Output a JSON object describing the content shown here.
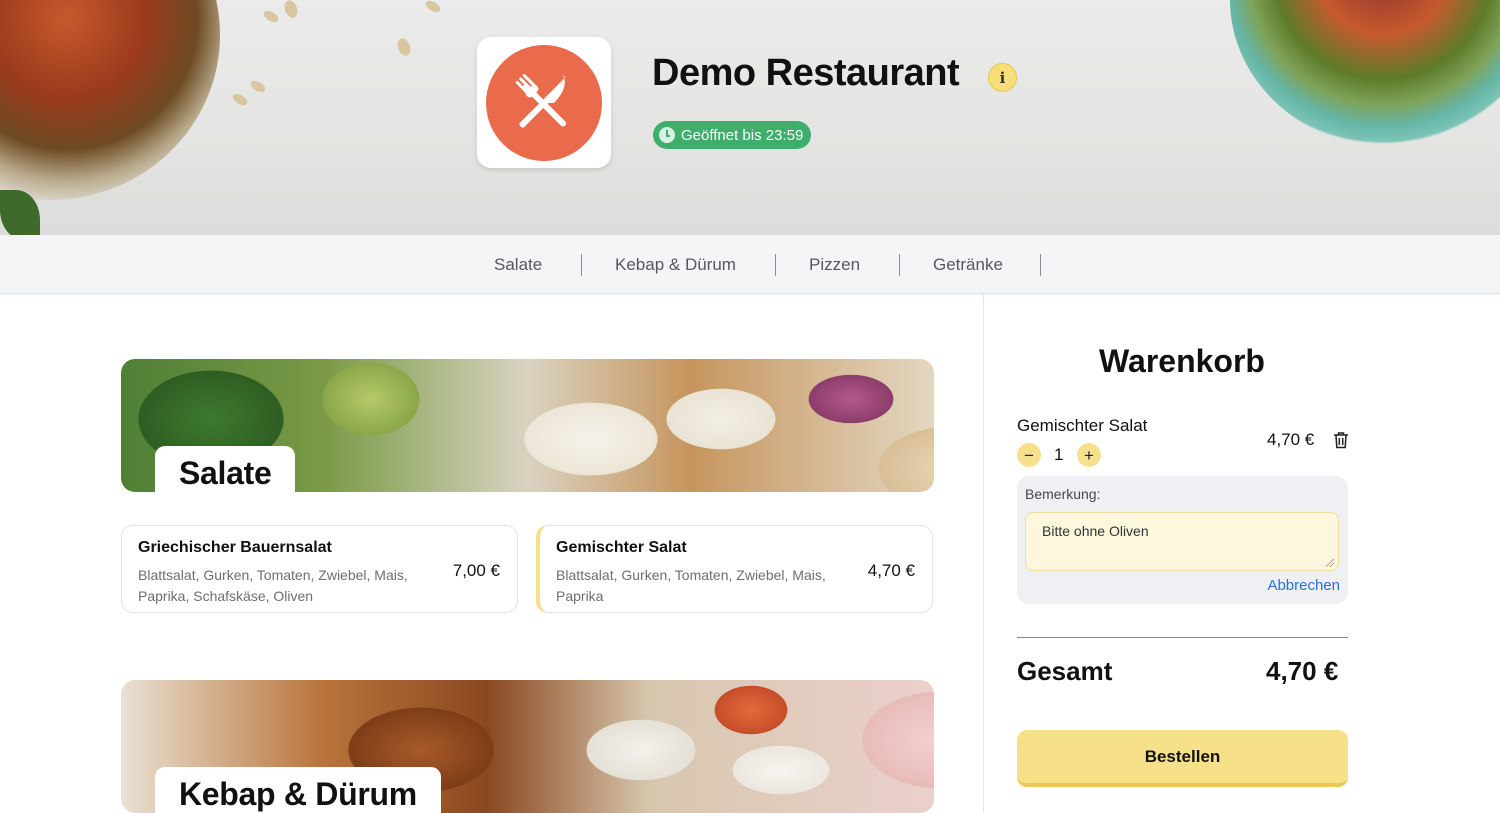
{
  "restaurant": {
    "name": "Demo Restaurant",
    "status": "Geöffnet bis 23:59",
    "info_icon": "i"
  },
  "nav": {
    "categories": [
      "Salate",
      "Kebap & Dürum",
      "Pizzen",
      "Getränke"
    ]
  },
  "menu": {
    "sections": [
      {
        "title": "Salate",
        "dishes": [
          {
            "name": "Griechischer Bauernsalat",
            "description": "Blattsalat, Gurken, Tomaten, Zwiebel, Mais, Paprika, Schafskäse, Oliven",
            "price": "7,00 €"
          },
          {
            "name": "Gemischter Salat",
            "description": "Blattsalat, Gurken, Tomaten, Zwiebel, Mais, Paprika",
            "price": "4,70 €"
          }
        ]
      },
      {
        "title": "Kebap & Dürum",
        "dishes": []
      }
    ]
  },
  "cart": {
    "title": "Warenkorb",
    "item": {
      "name": "Gemischter Salat",
      "price": "4,70 €",
      "quantity": "1",
      "decrement": "−",
      "increment": "+"
    },
    "remark": {
      "label": "Bemerkung:",
      "value": "Bitte ohne Oliven",
      "cancel": "Abbrechen"
    },
    "total_label": "Gesamt",
    "total_value": "4,70 €",
    "order_button": "Bestellen"
  },
  "colors": {
    "accent_yellow": "#f7e08a",
    "open_green": "#3fae6c",
    "logo_orange": "#ea6b4b",
    "link_blue": "#2d6fd6"
  },
  "icons": [
    "info-icon",
    "clock-icon",
    "cutlery-icon",
    "trash-icon"
  ]
}
